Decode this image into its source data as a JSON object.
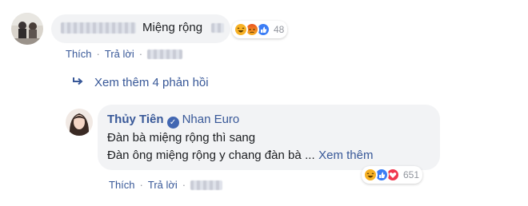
{
  "comment1": {
    "text": "Miệng rộng",
    "reactions": {
      "emojis": [
        "haha-icon",
        "angry-icon",
        "like-icon"
      ],
      "count": "48"
    },
    "actions": {
      "like": "Thích",
      "reply": "Trả lời"
    }
  },
  "view_more": {
    "label": "Xem thêm 4 phản hồi"
  },
  "comment2": {
    "author": "Thủy Tiên",
    "tagged": "Nhan Euro",
    "line1": "Đàn bà miệng rộng thì sang",
    "line2": "Đàn ông miệng rộng y chang đàn bà",
    "ellipsis": "...",
    "see_more": "Xem thêm",
    "reactions": {
      "emojis": [
        "haha-icon",
        "like-icon",
        "love-icon"
      ],
      "count": "651"
    },
    "actions": {
      "like": "Thích",
      "reply": "Trả lời"
    }
  },
  "colors": {
    "link": "#385898",
    "bubble": "#f2f3f5",
    "verified": "#4267b2"
  }
}
